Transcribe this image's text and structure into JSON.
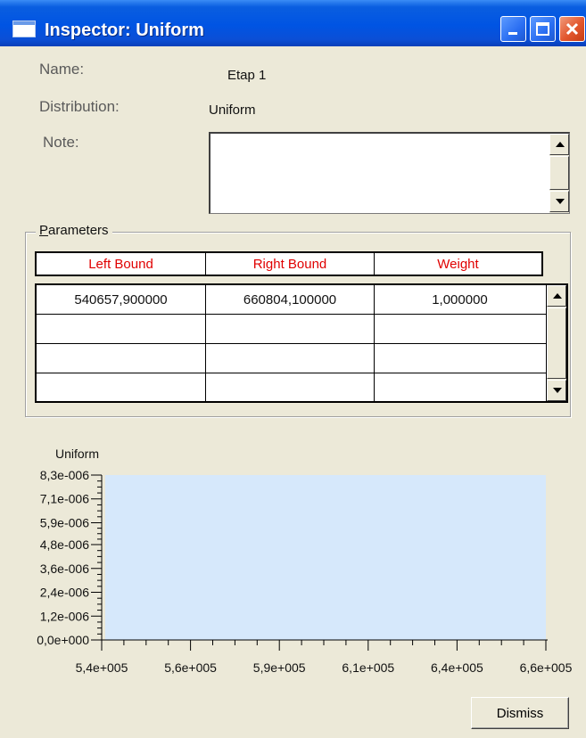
{
  "window": {
    "title": "Inspector: Uniform",
    "title_icon": "window-icon",
    "controls": [
      "minimize-icon",
      "maximize-icon",
      "close-icon"
    ]
  },
  "fields": {
    "name_label": "Name:",
    "name_value": "Etap 1",
    "distribution_label": "Distribution:",
    "distribution_value": "Uniform",
    "note_label": "Note:",
    "note_value": ""
  },
  "parameters": {
    "group_title_mnemonic": "P",
    "group_title_rest": "arameters",
    "columns": [
      "Left Bound",
      "Right Bound",
      "Weight"
    ],
    "header_color": "#e00000",
    "rows": [
      [
        "540657,900000",
        "660804,100000",
        "1,000000"
      ],
      [
        "",
        "",
        ""
      ],
      [
        "",
        "",
        ""
      ],
      [
        "",
        "",
        ""
      ]
    ]
  },
  "chart_data": {
    "type": "area",
    "title": "Uniform",
    "x": [
      540657.9,
      660804.1
    ],
    "y": [
      8.3e-06,
      8.3e-06
    ],
    "xlim": [
      540000,
      660000
    ],
    "ylim": [
      0,
      8.3e-06
    ],
    "x_ticks": [
      540000,
      560000,
      590000,
      610000,
      640000,
      660000
    ],
    "x_tick_labels": [
      "5,4e+005",
      "5,6e+005",
      "5,9e+005",
      "6,1e+005",
      "6,4e+005",
      "6,6e+005"
    ],
    "y_ticks": [
      0,
      1.2e-06,
      2.4e-06,
      3.6e-06,
      4.8e-06,
      5.9e-06,
      7.1e-06,
      8.3e-06
    ],
    "y_tick_labels": [
      "0,0e+000",
      "1,2e-006",
      "2,4e-006",
      "3,6e-006",
      "4,8e-006",
      "5,9e-006",
      "7,1e-006",
      "8,3e-006"
    ],
    "fill_color": "#d6e8fb",
    "grid": false,
    "xlabel": "",
    "ylabel": ""
  },
  "buttons": {
    "dismiss": "Dismiss"
  }
}
